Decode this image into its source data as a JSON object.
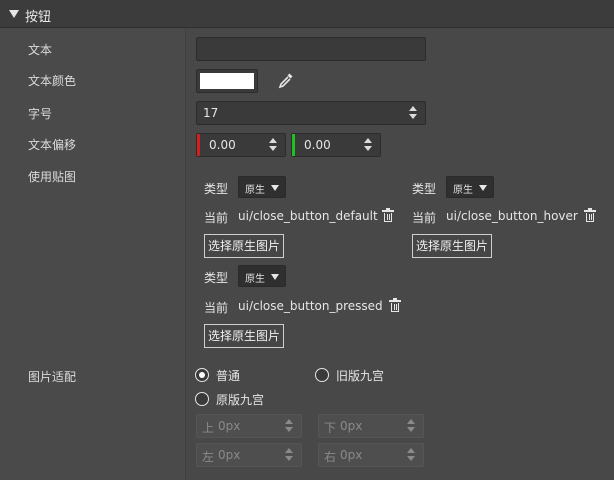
{
  "section": {
    "title": "按钮"
  },
  "labels": {
    "text": "文本",
    "text_color": "文本颜色",
    "font_size": "字号",
    "text_offset": "文本偏移",
    "use_texture": "使用贴图",
    "image_fit": "图片适配"
  },
  "fields": {
    "text_value": "",
    "text_color": "#ffffff",
    "font_size": "17",
    "offset_x": "0.00",
    "offset_y": "0.00"
  },
  "colors": {
    "offset_x_axis": "#d02020",
    "offset_y_axis": "#20c020"
  },
  "textures": [
    {
      "type_label": "类型",
      "type_value": "原生",
      "current_label": "当前",
      "path": "ui/close_button_default",
      "select_label": "选择原生图片"
    },
    {
      "type_label": "类型",
      "type_value": "原生",
      "current_label": "当前",
      "path": "ui/close_button_hover",
      "select_label": "选择原生图片"
    },
    {
      "type_label": "类型",
      "type_value": "原生",
      "current_label": "当前",
      "path": "ui/close_button_pressed",
      "select_label": "选择原生图片"
    }
  ],
  "image_fit": {
    "options": [
      "普通",
      "旧版九宫",
      "原版九宫"
    ],
    "selected": "普通",
    "margins": [
      {
        "prefix": "上",
        "value": "0px"
      },
      {
        "prefix": "下",
        "value": "0px"
      },
      {
        "prefix": "左",
        "value": "0px"
      },
      {
        "prefix": "右",
        "value": "0px"
      }
    ]
  },
  "icons": {
    "picker": "eyedropper-icon",
    "delete": "trash-icon",
    "collapse": "triangle-down-icon"
  }
}
